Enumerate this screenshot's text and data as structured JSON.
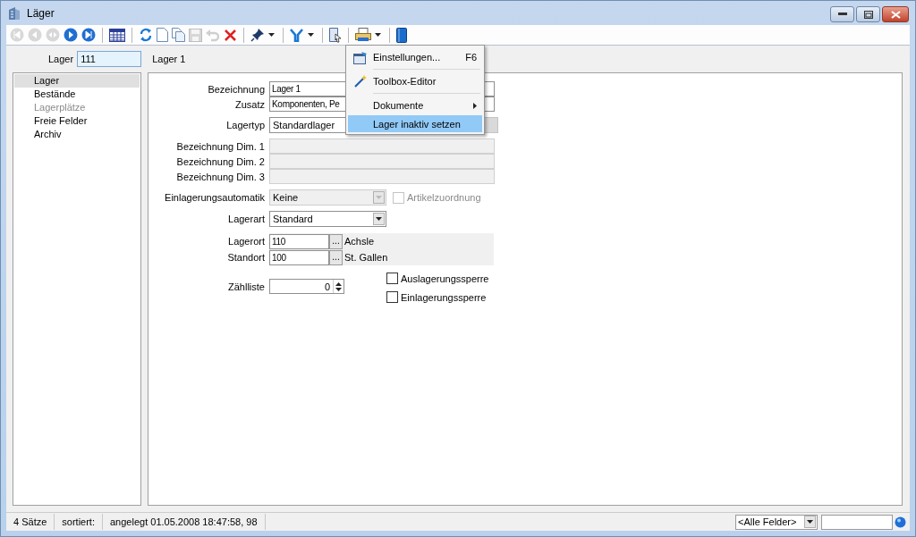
{
  "window": {
    "title": "Läger"
  },
  "toolbar": [
    {
      "kind": "first",
      "disabled": true
    },
    {
      "kind": "prev",
      "disabled": true
    },
    {
      "kind": "jump",
      "disabled": true
    },
    {
      "kind": "next",
      "disabled": false
    },
    {
      "kind": "last",
      "disabled": false
    },
    {
      "kind": "sep"
    },
    {
      "kind": "table",
      "disabled": false
    },
    {
      "kind": "sep"
    },
    {
      "kind": "refresh",
      "disabled": false
    },
    {
      "kind": "new",
      "disabled": false
    },
    {
      "kind": "copy",
      "disabled": false
    },
    {
      "kind": "save",
      "disabled": true
    },
    {
      "kind": "undo",
      "disabled": true
    },
    {
      "kind": "delete",
      "disabled": false
    },
    {
      "kind": "sep"
    },
    {
      "kind": "pin",
      "disabled": false
    },
    {
      "kind": "caret",
      "disabled": false
    },
    {
      "kind": "sep"
    },
    {
      "kind": "filter",
      "disabled": false
    },
    {
      "kind": "caret",
      "disabled": false
    },
    {
      "kind": "sep"
    },
    {
      "kind": "docpointer",
      "disabled": false
    },
    {
      "kind": "sep"
    },
    {
      "kind": "printer",
      "disabled": false
    },
    {
      "kind": "caret",
      "disabled": false
    },
    {
      "kind": "sep"
    },
    {
      "kind": "book",
      "disabled": false
    }
  ],
  "record": {
    "label": "Lager",
    "value": "111",
    "name": "Lager 1"
  },
  "sidebar": {
    "items": [
      {
        "label": "Lager",
        "selected": true,
        "disabled": false
      },
      {
        "label": "Bestände",
        "selected": false,
        "disabled": false
      },
      {
        "label": "Lagerplätze",
        "selected": false,
        "disabled": true
      },
      {
        "label": "Freie Felder",
        "selected": false,
        "disabled": false
      },
      {
        "label": "Archiv",
        "selected": false,
        "disabled": false
      }
    ]
  },
  "form": {
    "bezeichnung": {
      "label": "Bezeichnung",
      "value": "Lager 1"
    },
    "zusatz": {
      "label": "Zusatz",
      "value": "Komponenten, Pe"
    },
    "lagertyp": {
      "label": "Lagertyp",
      "value": "Standardlager"
    },
    "dims": [
      {
        "label": "Bezeichnung Dim. 1"
      },
      {
        "label": "Bezeichnung Dim. 2"
      },
      {
        "label": "Bezeichnung Dim. 3"
      }
    ],
    "einlagerung": {
      "label": "Einlagerungsautomatik",
      "value": "Keine",
      "disabled": true,
      "check_label": "Artikelzuordnung",
      "checked": false,
      "check_disabled": true
    },
    "lagerart": {
      "label": "Lagerart",
      "value": "Standard"
    },
    "lookups": [
      {
        "label": "Lagerort",
        "value": "110",
        "button": "...",
        "name": "Achsle"
      },
      {
        "label": "Standort",
        "value": "100",
        "button": "...",
        "name": "St. Gallen"
      }
    ],
    "zaehlliste": {
      "label": "Zählliste",
      "value": "0"
    },
    "checkboxes": [
      {
        "label": "Auslagerungssperre",
        "checked": false
      },
      {
        "label": "Einlagerungssperre",
        "checked": false
      }
    ]
  },
  "context_menu": {
    "items": [
      {
        "kind": "item",
        "icon": true,
        "label": "Einstellungen...",
        "shortcut": "F6",
        "submenu": false,
        "selected": false
      },
      {
        "kind": "separator"
      },
      {
        "kind": "item",
        "icon": true,
        "label": "Toolbox-Editor",
        "submenu": false,
        "selected": false
      },
      {
        "kind": "separator"
      },
      {
        "kind": "item",
        "icon": false,
        "label": "Dokumente",
        "submenu": true,
        "selected": false
      },
      {
        "kind": "item",
        "icon": false,
        "label": "Lager inaktiv setzen",
        "submenu": false,
        "selected": true
      }
    ]
  },
  "status_bar": {
    "records": "4 Sätze",
    "sorted": "sortiert:",
    "created": "angelegt 01.05.2008 18:47:58, 98",
    "field_filter": "<Alle Felder>"
  }
}
